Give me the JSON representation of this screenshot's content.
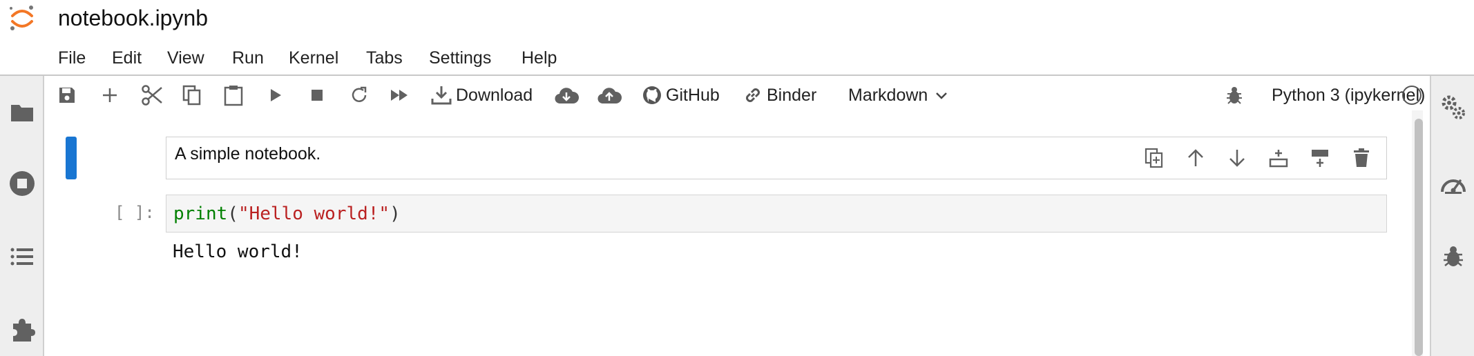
{
  "app": {
    "title": "notebook.ipynb",
    "accent_color": "#f37726",
    "active_cell_color": "#1976d2"
  },
  "menu": [
    "File",
    "Edit",
    "View",
    "Run",
    "Kernel",
    "Tabs",
    "Settings",
    "Help"
  ],
  "toolbar": {
    "icons": [
      "save-icon",
      "plus-icon",
      "scissors-icon",
      "copy-icon",
      "paste-icon",
      "run-icon",
      "stop-icon",
      "restart-icon",
      "fast-forward-icon"
    ],
    "download_label": "Download",
    "github_label": "GitHub",
    "binder_label": "Binder",
    "cell_type": "Markdown",
    "kernel_name": "Python 3 (ipykernel)"
  },
  "left_sidebar": [
    "folder-icon",
    "running-icon",
    "toc-icon",
    "extensions-icon"
  ],
  "right_sidebar": [
    "property-inspector-icon",
    "gauge-icon",
    "debugger-icon"
  ],
  "cells": {
    "markdown_text": "A simple notebook.",
    "code_prompt": "[ ]:",
    "code_fn": "print",
    "code_open": "(",
    "code_string": "\"Hello world!\"",
    "code_close": ")",
    "output_text": "Hello world!"
  },
  "cell_tools": [
    "duplicate-icon",
    "move-up-icon",
    "move-down-icon",
    "insert-above-icon",
    "insert-below-icon",
    "delete-icon"
  ]
}
